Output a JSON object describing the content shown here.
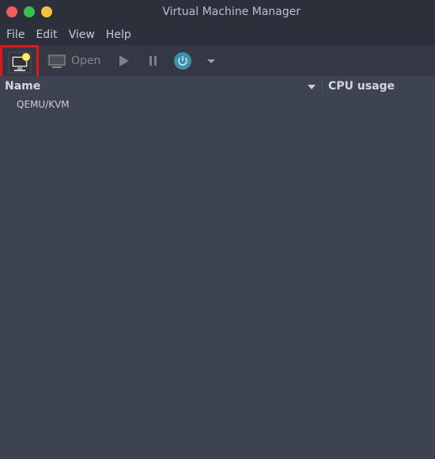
{
  "window": {
    "title": "Virtual Machine Manager"
  },
  "menu": [
    "File",
    "Edit",
    "View",
    "Help"
  ],
  "toolbar": {
    "new_vm_icon": "monitor-star-icon",
    "open_label": "Open",
    "run_icon": "play-icon",
    "pause_icon": "pause-icon",
    "shutdown_icon": "power-icon",
    "shutdown_menu_icon": "chevron-down-icon"
  },
  "columns": {
    "name": "Name",
    "cpu": "CPU usage"
  },
  "rows": [
    {
      "name": "QEMU/KVM"
    }
  ],
  "colors": {
    "close": "#ec5f5e",
    "maximize": "#37c14a",
    "minimize": "#f3c33a",
    "highlight": "#e0161d",
    "power": "#3d8fae"
  }
}
